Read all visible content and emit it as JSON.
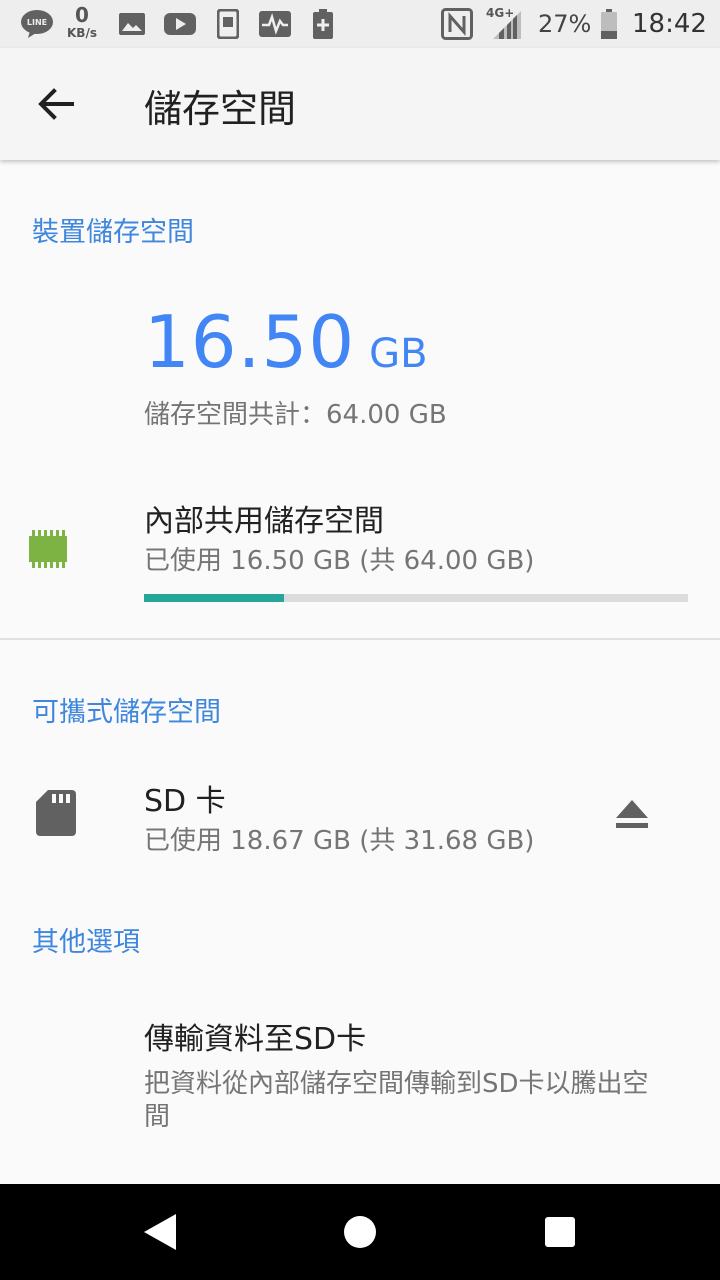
{
  "status_bar": {
    "data_rate_value": "0",
    "data_rate_unit": "KB/s",
    "line_label": "LINE",
    "network_type": "4G+",
    "battery_percent": "27%",
    "time": "18:42",
    "icons": [
      "line-icon",
      "image-icon",
      "youtube-icon",
      "phone-manager-icon",
      "activity-icon",
      "battery-saver-icon",
      "nfc-icon",
      "signal-icon",
      "battery-icon"
    ]
  },
  "app_bar": {
    "title": "儲存空間",
    "back_icon": "arrow-back-icon"
  },
  "device_storage": {
    "header": "裝置儲存空間",
    "used_value": "16.50",
    "used_unit": "GB",
    "total_text": "儲存空間共計：64.00 GB",
    "internal": {
      "title": "內部共用儲存空間",
      "subtitle": "已使用 16.50 GB (共 64.00 GB)",
      "used_fraction": 0.258,
      "icon": "memory-chip-icon"
    }
  },
  "portable_storage": {
    "header": "可攜式儲存空間",
    "sd_card": {
      "title": "SD 卡",
      "subtitle": "已使用 18.67 GB (共 31.68 GB)",
      "icon": "sd-card-icon",
      "action_icon": "eject-icon"
    }
  },
  "other_options": {
    "header": "其他選項",
    "transfer": {
      "title": "傳輸資料至SD卡",
      "subtitle_line1": "把資料從內部儲存空間傳輸到SD卡以騰出空",
      "subtitle_line2": "間"
    }
  },
  "colors": {
    "accent_blue": "#4285f4",
    "section_header_blue": "#3f87dd",
    "progress_teal": "#26a69a",
    "chip_green": "#7cb342"
  }
}
